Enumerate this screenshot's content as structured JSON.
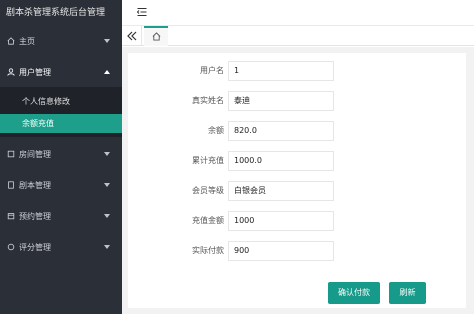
{
  "app_title": "剧本杀管理系统后台管理",
  "sidebar": {
    "menu": [
      {
        "label": "主页",
        "icon": "home-icon"
      },
      {
        "label": "用户管理",
        "icon": "user-icon"
      },
      {
        "label": "房间管理",
        "icon": "room-icon"
      },
      {
        "label": "剧本管理",
        "icon": "script-icon"
      },
      {
        "label": "预约管理",
        "icon": "reservation-icon"
      },
      {
        "label": "评分管理",
        "icon": "rating-icon"
      }
    ],
    "submenu": [
      {
        "label": "个人信息修改"
      },
      {
        "label": "余额充值"
      }
    ]
  },
  "colors": {
    "sidebar_bg": "#2b2f38",
    "accent": "#1e9f8c",
    "button": "#169a89"
  },
  "form": {
    "fields": [
      {
        "label": "用户名",
        "value": "1"
      },
      {
        "label": "真实姓名",
        "value": "泰迪"
      },
      {
        "label": "余额",
        "value": "820.0"
      },
      {
        "label": "累计充值",
        "value": "1000.0"
      },
      {
        "label": "会员等级",
        "value": "白银会员"
      },
      {
        "label": "充值金额",
        "value": "1000"
      },
      {
        "label": "实际付款",
        "value": "900"
      }
    ],
    "confirm_label": "确认付款",
    "refresh_label": "刷新"
  }
}
